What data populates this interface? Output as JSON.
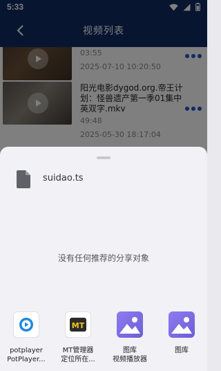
{
  "status_bar": {
    "time": "5:33",
    "icons": [
      "wifi-icon",
      "signal-icon",
      "battery-icon"
    ]
  },
  "header": {
    "title": "视频列表",
    "back_icon": "back-arrow-icon"
  },
  "videos": [
    {
      "name": "",
      "duration": "03:55",
      "date": "2025-07-10 10:20:50"
    },
    {
      "name": "阳光电影dygod.org.帝王计划：怪兽遗产第一季01集中英双字.mkv",
      "duration": "49:48",
      "date": "2025-05-30 18:17:04"
    }
  ],
  "share_sheet": {
    "file_name": "suidao.ts",
    "empty_message": "没有任何推荐的分享对象",
    "apps": [
      {
        "label": "potplayer",
        "sub": "PotPlayer...",
        "icon": "potplayer-icon",
        "color": "#1e88e5"
      },
      {
        "label": "MT管理器",
        "sub": "定位所在...",
        "icon": "mt-manager-icon",
        "color": "#2b2b2b"
      },
      {
        "label": "图库",
        "sub": "视频播放器",
        "icon": "gallery-icon",
        "color": "#8a7ae8"
      },
      {
        "label": "图库",
        "sub": "",
        "icon": "gallery-icon",
        "color": "#8a7ae8"
      }
    ]
  }
}
